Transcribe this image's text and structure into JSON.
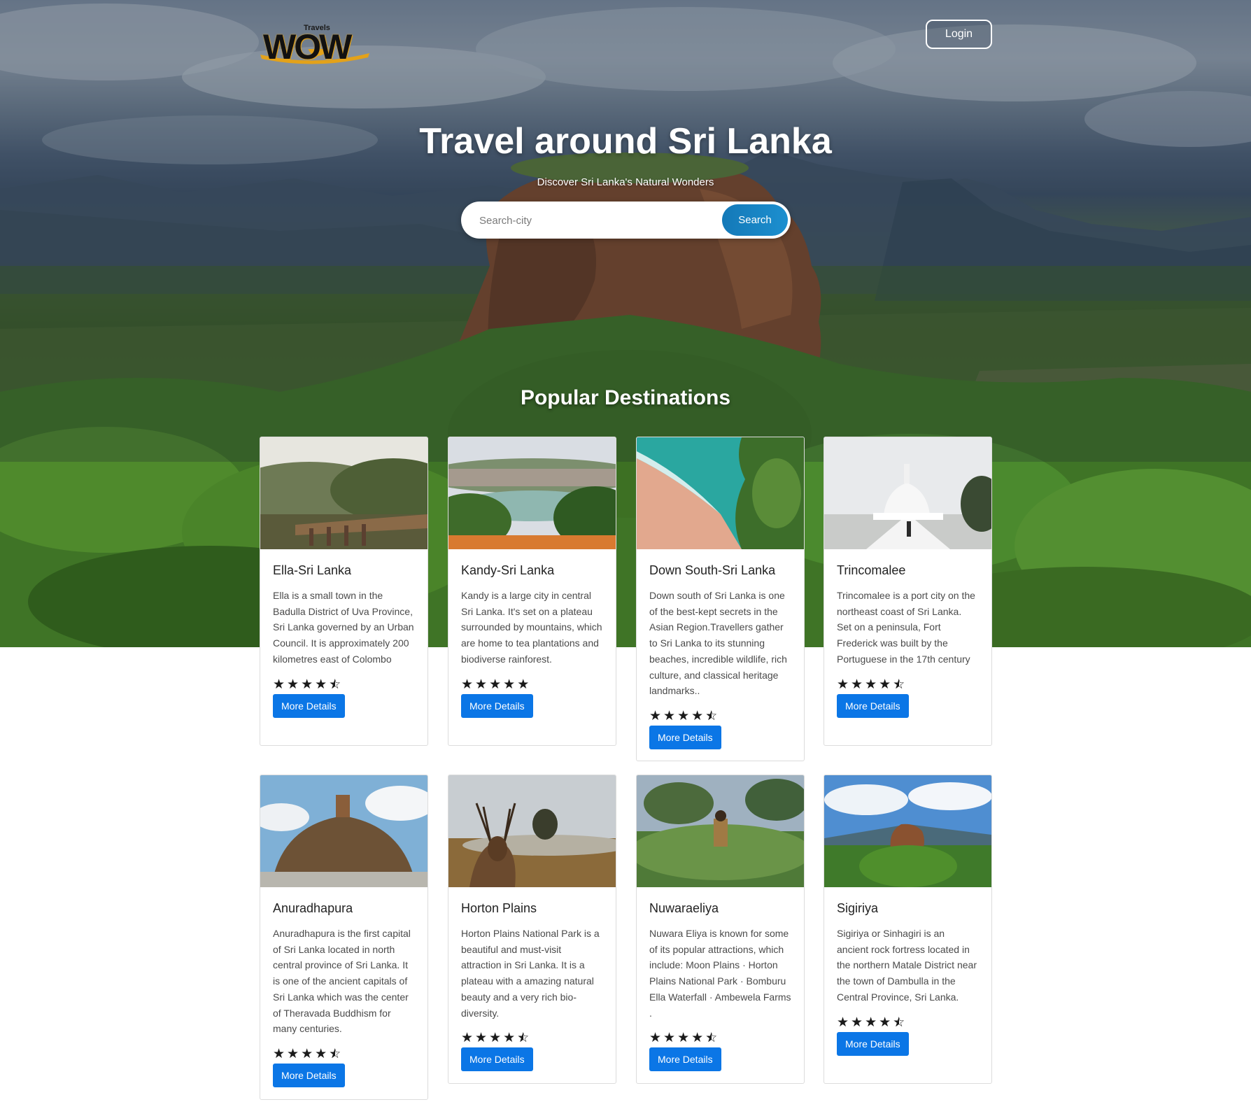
{
  "header": {
    "logo_text": "WOW",
    "logo_travels": "Travels",
    "login_label": "Login"
  },
  "hero": {
    "title": "Travel around Sri Lanka",
    "subtitle": "Discover Sri Lanka's Natural Wonders",
    "search_placeholder": "Search-city",
    "search_button": "Search"
  },
  "destinations": {
    "section_title": "Popular Destinations",
    "button_label": "More Details",
    "cards": [
      {
        "title": "Ella-Sri Lanka",
        "text": "Ella is a small town in the Badulla District of Uva Province, Sri Lanka governed by an Urban Council. It is approximately 200 kilometres east of Colombo",
        "rating": 4.5,
        "image": "bridge-forest"
      },
      {
        "title": "Kandy-Sri Lanka",
        "text": "Kandy is a large city in central Sri Lanka. It's set on a plateau surrounded by mountains, which are home to tea plantations and biodiverse rainforest.",
        "rating": 5,
        "image": "lake-city"
      },
      {
        "title": "Down South-Sri Lanka",
        "text": "Down south of Sri Lanka is one of the best-kept secrets in the Asian Region.Travellers gather to Sri Lanka to its stunning beaches, incredible wildlife, rich culture, and classical heritage landmarks..",
        "rating": 4.5,
        "image": "beach-aerial"
      },
      {
        "title": "Trincomalee",
        "text": "Trincomalee is a port city on the northeast coast of Sri Lanka. Set on a peninsula, Fort Frederick was built by the Portuguese in the 17th century",
        "rating": 4.5,
        "image": "white-stupa"
      },
      {
        "title": "Anuradhapura",
        "text": "Anuradhapura is the first capital of Sri Lanka located in north central province of Sri Lanka. It is one of the ancient capitals of Sri Lanka which was the center of Theravada Buddhism for many centuries.",
        "rating": 4.5,
        "image": "brick-stupa"
      },
      {
        "title": "Horton Plains",
        "text": "Horton Plains National Park is a beautiful and must-visit attraction in Sri Lanka. It is a plateau with a amazing natural beauty and a very rich bio-diversity.",
        "rating": 4.5,
        "image": "deer-plains"
      },
      {
        "title": "Nuwaraeliya",
        "text": "Nuwara Eliya is known for some of its popular attractions, which include: Moon Plains · Horton Plains National Park · Bomburu Ella Waterfall · Ambewela Farms .",
        "rating": 4.5,
        "image": "tea-plucker"
      },
      {
        "title": "Sigiriya",
        "text": "Sigiriya or Sinhagiri is an ancient rock fortress located in the northern Matale District near the town of Dambulla in the Central Province, Sri Lanka.",
        "rating": 4.5,
        "image": "rock-fortress"
      }
    ]
  },
  "colors": {
    "accent": "#0b76e6",
    "search_button": "#1479b8",
    "logo_gold": "#e3a21a"
  }
}
